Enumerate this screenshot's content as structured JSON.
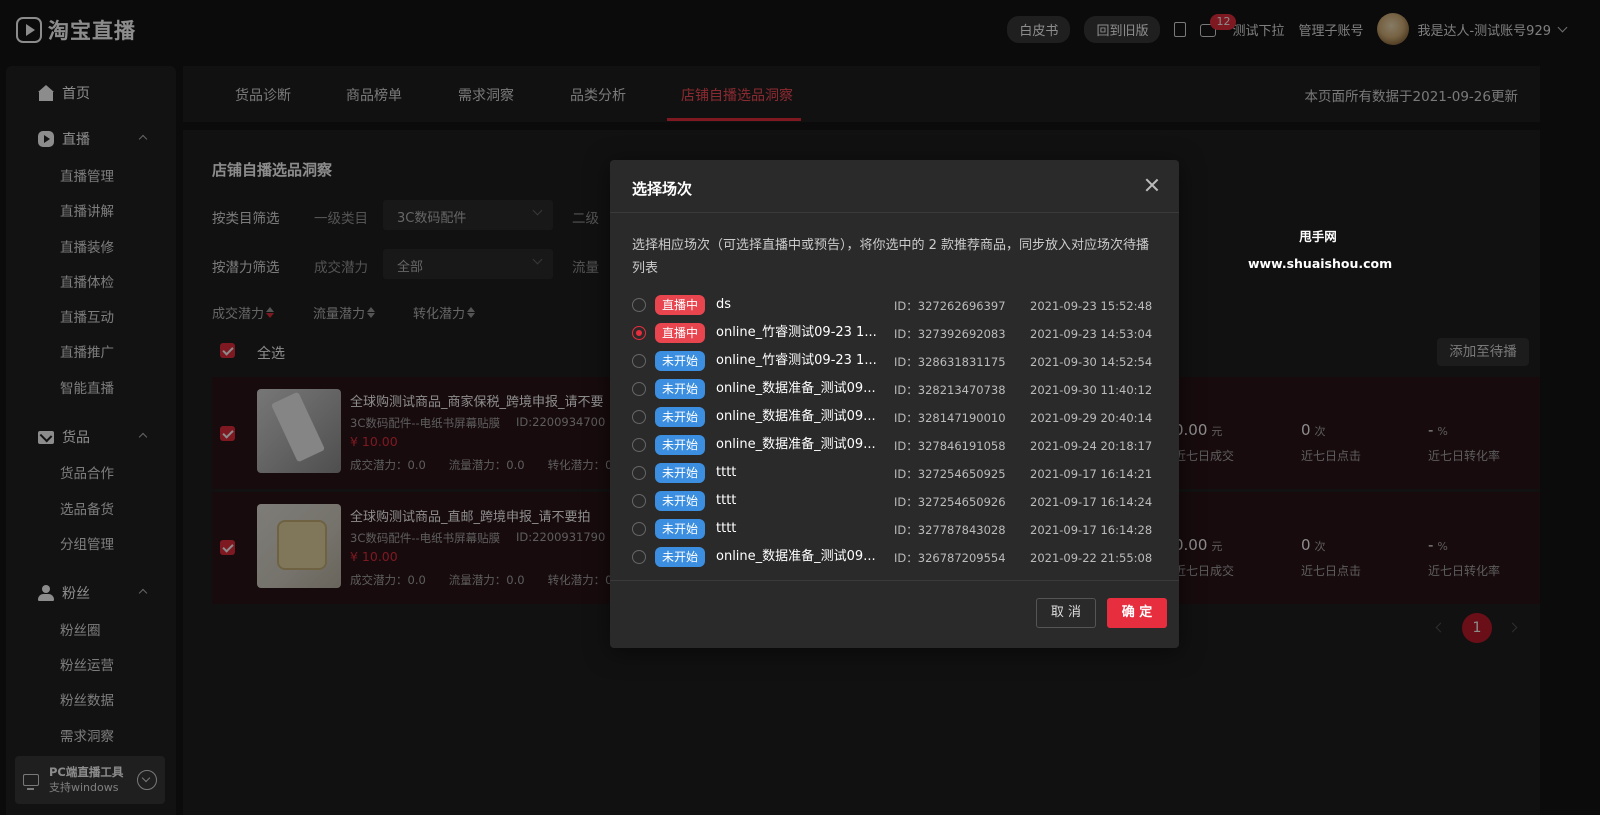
{
  "header": {
    "logo_text": "淘宝直播",
    "whitepaper": "白皮书",
    "old_version": "回到旧版",
    "msg_count": "12",
    "test_dropdown": "测试下拉",
    "sub_account": "管理子账号",
    "username": "我是达人-测试账号929"
  },
  "sidebar": {
    "home": "首页",
    "live": {
      "title": "直播",
      "items": [
        "直播管理",
        "直播讲解",
        "直播装修",
        "直播体检",
        "直播互动",
        "直播推广",
        "智能直播"
      ]
    },
    "goods": {
      "title": "货品",
      "items": [
        "货品合作",
        "选品备货",
        "分组管理"
      ]
    },
    "fans": {
      "title": "粉丝",
      "items": [
        "粉丝圈",
        "粉丝运营",
        "粉丝数据",
        "需求洞察"
      ]
    },
    "pc_tool": {
      "title": "PC端直播工具",
      "sub": "支持windows"
    }
  },
  "tabs": {
    "items": [
      "货品诊断",
      "商品榜单",
      "需求洞察",
      "品类分析",
      "店铺自播选品洞察"
    ],
    "update_note": "本页面所有数据于2021-09-26更新"
  },
  "content": {
    "title": "店铺自播选品洞察",
    "filter_cat_label": "按类目筛选",
    "level1_label": "一级类目",
    "level1_value": "3C数码配件",
    "level2_label": "二级",
    "filter_pot_label": "按潜力筛选",
    "deal_pot_label": "成交潜力",
    "deal_pot_value": "全部",
    "traffic_label": "流量",
    "sorts": [
      "成交潜力",
      "流量潜力",
      "转化潜力"
    ],
    "select_all": "全选",
    "add_btn": "添加至待播",
    "products": [
      {
        "name": "全球购测试商品_商家保税_跨境申报_请不要",
        "sub": "3C数码配件--电纸书屏幕贴膜",
        "id": "ID:2200934700",
        "price": "¥ 10.00",
        "potential": "成交潜力：0.0　　流量潜力：0.0　　转化潜力：0",
        "sales": "0.00",
        "sales_unit": "元",
        "sales_label": "近七日成交",
        "clicks": "0",
        "clicks_unit": "次",
        "clicks_label": "近七日点击",
        "conv": "-",
        "conv_unit": "%",
        "conv_label": "近七日转化率"
      },
      {
        "name": "全球购测试商品_直邮_跨境申报_请不要拍",
        "sub": "3C数码配件--电纸书屏幕贴膜",
        "id": "ID:2200931790",
        "price": "¥ 10.00",
        "potential": "成交潜力：0.0　　流量潜力：0.0　　转化潜力：0",
        "sales": "0.00",
        "sales_unit": "元",
        "sales_label": "近七日成交",
        "clicks": "0",
        "clicks_unit": "次",
        "clicks_label": "近七日点击",
        "conv": "-",
        "conv_unit": "%",
        "conv_label": "近七日转化率"
      }
    ],
    "page": "1"
  },
  "watermark": {
    "line1": "甩手网",
    "line2": "www.shuaishou.com"
  },
  "modal": {
    "title": "选择场次",
    "desc": "选择相应场次（可选择直播中或预告），将你选中的 2 款推荐商品，同步放入对应场次待播列表",
    "cancel": "取 消",
    "ok": "确 定",
    "sessions": [
      {
        "status": "直播中",
        "live": true,
        "checked": false,
        "name": "ds",
        "id": "ID：327262696397",
        "time": "2021-09-23 15:52:48"
      },
      {
        "status": "直播中",
        "live": true,
        "checked": true,
        "name": "online_竹睿测试09-23 1...",
        "id": "ID：327392692083",
        "time": "2021-09-23 14:53:04"
      },
      {
        "status": "未开始",
        "live": false,
        "checked": false,
        "name": "online_竹睿测试09-23 1...",
        "id": "ID：328631831175",
        "time": "2021-09-30 14:52:54"
      },
      {
        "status": "未开始",
        "live": false,
        "checked": false,
        "name": "online_数据准备_测试09...",
        "id": "ID：328213470738",
        "time": "2021-09-30 11:40:12"
      },
      {
        "status": "未开始",
        "live": false,
        "checked": false,
        "name": "online_数据准备_测试09...",
        "id": "ID：328147190010",
        "time": "2021-09-29 20:40:14"
      },
      {
        "status": "未开始",
        "live": false,
        "checked": false,
        "name": "online_数据准备_测试09...",
        "id": "ID：327846191058",
        "time": "2021-09-24 20:18:17"
      },
      {
        "status": "未开始",
        "live": false,
        "checked": false,
        "name": "tttt",
        "id": "ID：327254650925",
        "time": "2021-09-17 16:14:21"
      },
      {
        "status": "未开始",
        "live": false,
        "checked": false,
        "name": "tttt",
        "id": "ID：327254650926",
        "time": "2021-09-17 16:14:24"
      },
      {
        "status": "未开始",
        "live": false,
        "checked": false,
        "name": "tttt",
        "id": "ID：327787843028",
        "time": "2021-09-17 16:14:28"
      },
      {
        "status": "未开始",
        "live": false,
        "checked": false,
        "name": "online_数据准备_测试09...",
        "id": "ID：326787209554",
        "time": "2021-09-22 21:55:08"
      }
    ]
  }
}
